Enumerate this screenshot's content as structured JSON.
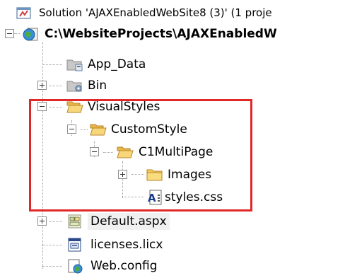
{
  "solution_explorer": {
    "solution_label": "Solution 'AJAXEnabledWebSite8 (3)' (1 proje",
    "project_path": "C:\\WebsiteProjects\\AJAXEnabledW",
    "items": {
      "app_data": "App_Data",
      "bin": "Bin",
      "visual_styles": "VisualStyles",
      "custom_style": "CustomStyle",
      "c1_multipage": "C1MultiPage",
      "images": "Images",
      "styles_css": "styles.css",
      "default_aspx": "Default.aspx",
      "licenses_licx": "licenses.licx",
      "web_config": "Web.config"
    },
    "highlight_color": "#e02828"
  }
}
